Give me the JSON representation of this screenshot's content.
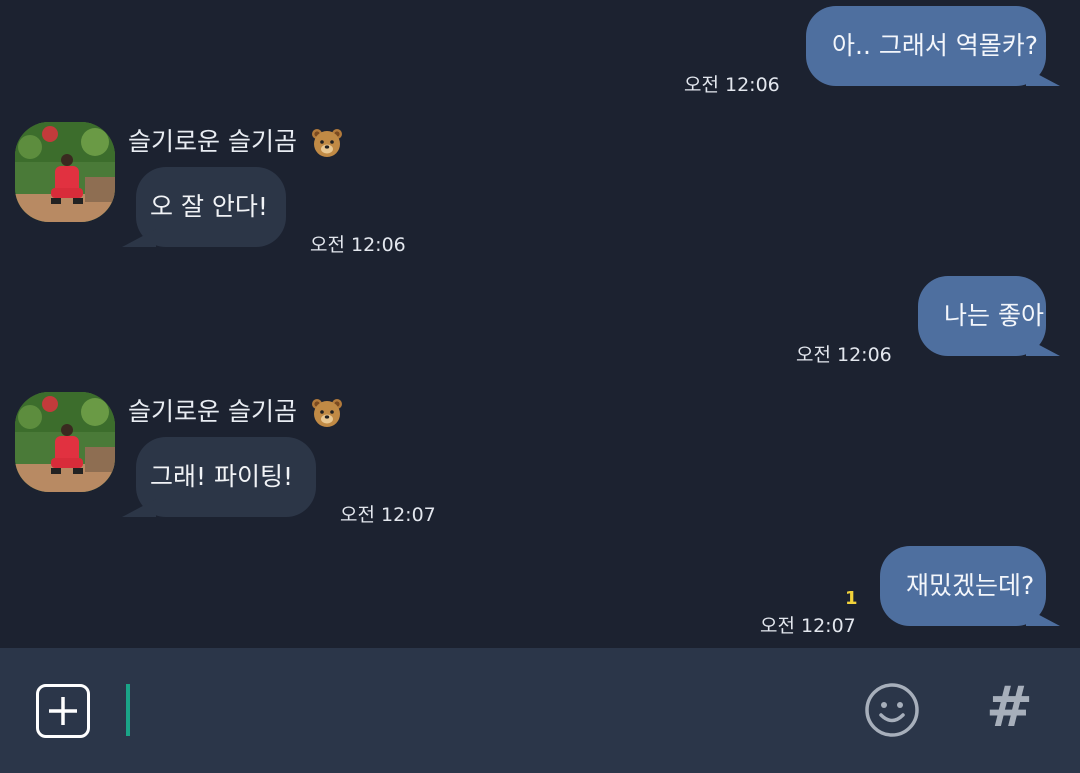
{
  "messages": [
    {
      "dir": "out",
      "text": "아.. 그래서 역몰카?",
      "time": "오전 12:06"
    },
    {
      "dir": "in",
      "sender": "슬기로운 슬기곰",
      "sender_emoji": "bear-face",
      "text": "오 잘 안다!",
      "time": "오전 12:06"
    },
    {
      "dir": "out",
      "text": "나는 좋아",
      "time": "오전 12:06"
    },
    {
      "dir": "in",
      "sender": "슬기로운 슬기곰",
      "sender_emoji": "bear-face",
      "text": "그래! 파이팅!",
      "time": "오전 12:07"
    },
    {
      "dir": "out",
      "text": "재밌겠는데?",
      "time": "오전 12:07",
      "unread": "1"
    }
  ],
  "input": {
    "value": ""
  },
  "colors": {
    "background": "#1c2230",
    "outgoing_bubble": "#4e6f9f",
    "incoming_bubble": "#2c3647",
    "input_bar": "#2b3649",
    "caret": "#1aa487",
    "unread": "#f2d23a"
  },
  "icons": {
    "attach": "plus-box-icon",
    "emoji": "smiley-icon",
    "hashtag": "hash-icon"
  }
}
